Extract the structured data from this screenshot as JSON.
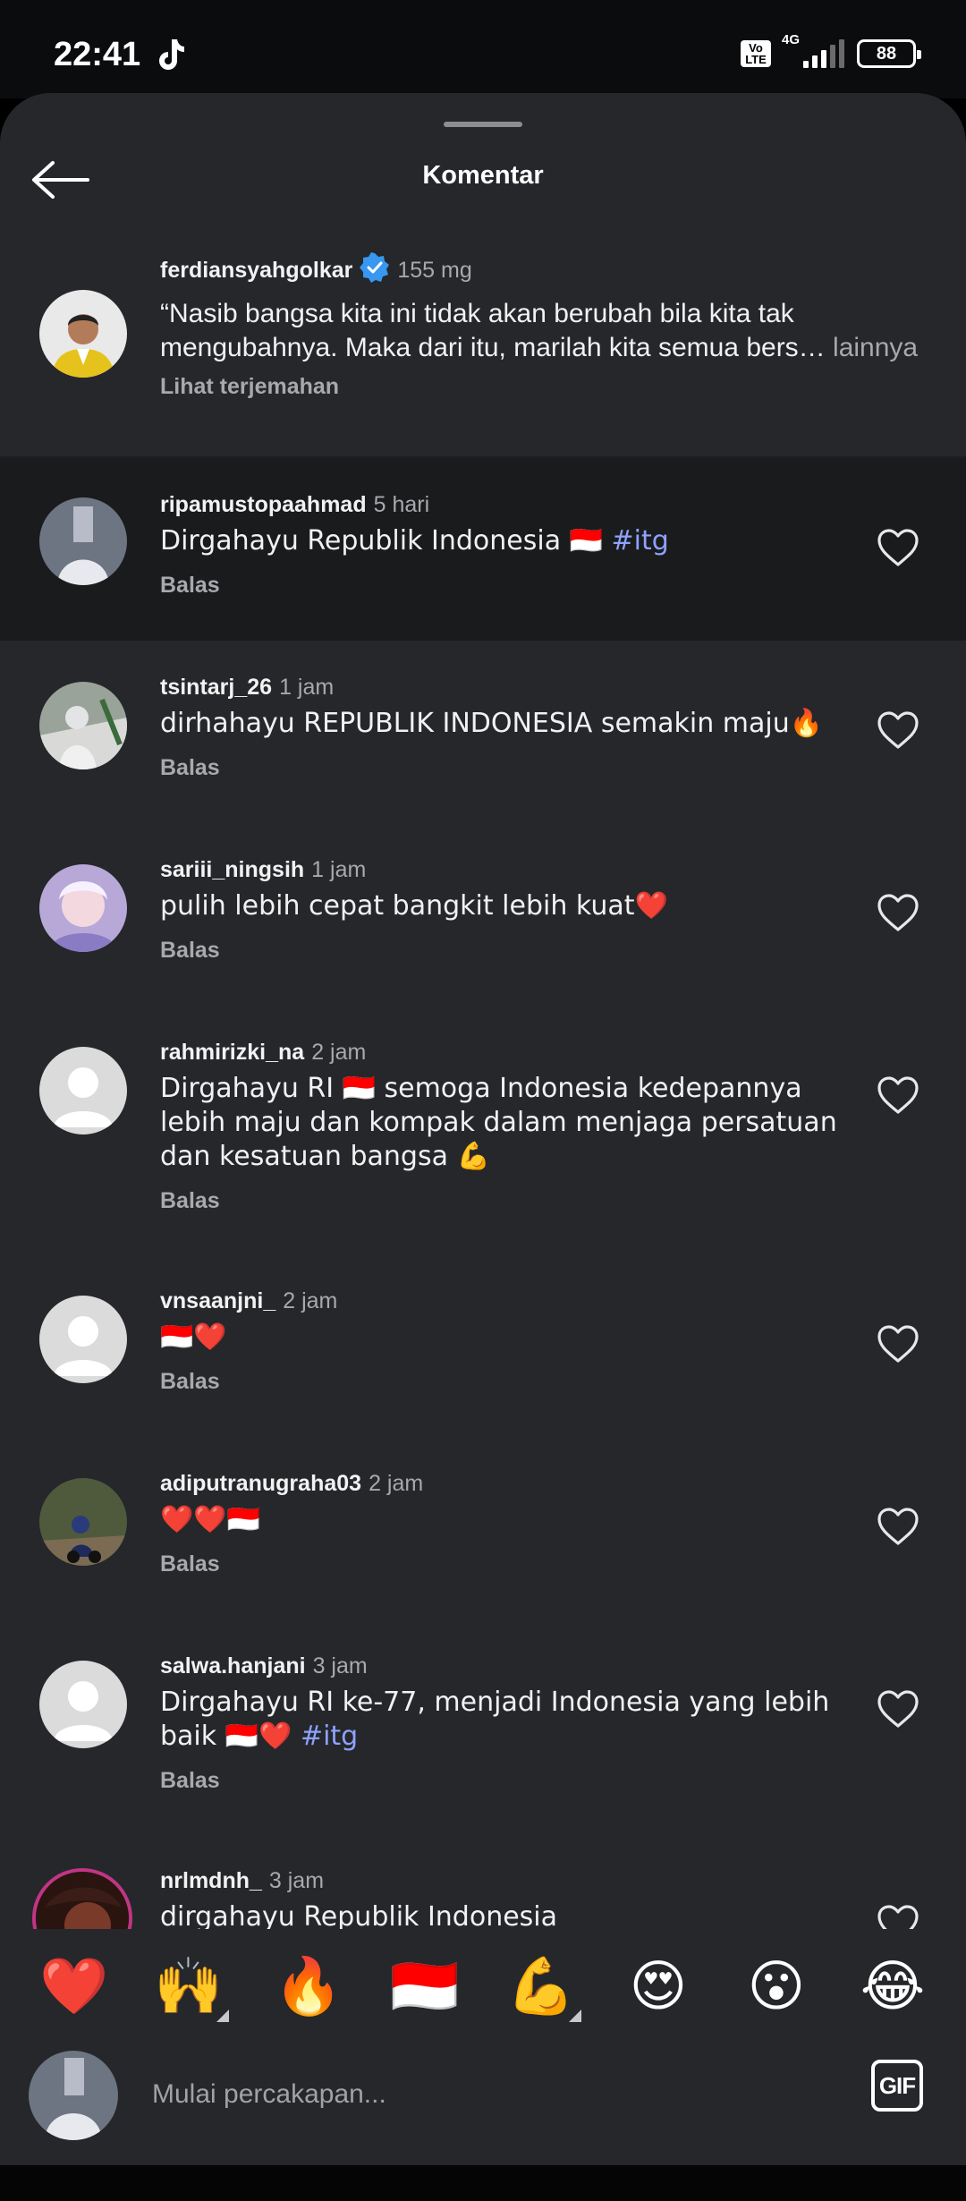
{
  "status_bar": {
    "time": "22:41",
    "network": "4G",
    "volte": "Vo LTE",
    "battery": "88"
  },
  "header": {
    "title": "Komentar"
  },
  "caption": {
    "username": "ferdiansyahgolkar",
    "time": "155 mg",
    "text": "“Nasib bangsa kita ini tidak akan berubah bila kita tak mengubahnya. Maka dari itu, marilah kita semua bers…",
    "more": "lainnya",
    "translate": "Lihat terjemahan"
  },
  "reply_label": "Balas",
  "comments": [
    {
      "username": "ripamustopaahmad",
      "time": "5 hari",
      "text": "Dirgahayu Republik Indonesia 🇮🇩",
      "hashtag": "#itg"
    },
    {
      "username": "tsintarj_26",
      "time": "1 jam",
      "text": "dirhahayu REPUBLIK INDONESIA semakin maju🔥"
    },
    {
      "username": "sariii_ningsih",
      "time": "1 jam",
      "text": "pulih lebih cepat bangkit lebih kuat❤️"
    },
    {
      "username": "rahmirizki_na",
      "time": "2 jam",
      "text": "Dirgahayu RI 🇮🇩 semoga Indonesia kedepannya lebih maju dan kompak dalam menjaga persatuan dan kesatuan bangsa 💪"
    },
    {
      "username": "vnsaanjni_",
      "time": "2 jam",
      "text": "🇮🇩❤️"
    },
    {
      "username": "adiputranugraha03",
      "time": "2 jam",
      "text": "❤️❤️🇮🇩"
    },
    {
      "username": "salwa.hanjani",
      "time": "3 jam",
      "text": "Dirgahayu RI ke-77, menjadi Indonesia yang lebih baik 🇮🇩❤️",
      "hashtag": "#itg"
    },
    {
      "username": "nrlmdnh_",
      "time": "3 jam",
      "text": "dirgahayu Republik Indonesia"
    }
  ],
  "emoji_bar": [
    "❤️",
    "🙌",
    "🔥",
    "🇮🇩",
    "💪",
    "😍",
    "😮",
    "😂"
  ],
  "input": {
    "placeholder": "Mulai percakapan...",
    "gif_label": "GIF"
  },
  "colors": {
    "background": "#25272b",
    "highlight": "#1a1b1d",
    "hashtag": "#8ea2ff",
    "verified": "#3897f0"
  }
}
